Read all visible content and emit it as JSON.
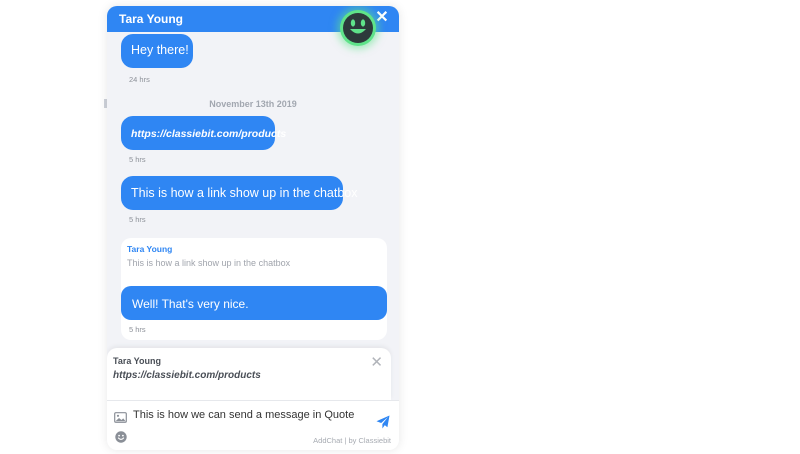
{
  "header": {
    "title": "Tara Young",
    "close_icon": "close-icon",
    "avatar_icon": "smiley-icon"
  },
  "messages": [
    {
      "text": "Hey there!",
      "time": "24 hrs"
    },
    {
      "date": "November 13th 2019"
    },
    {
      "text": "https://classiebit.com/products",
      "time": "5 hrs"
    },
    {
      "text": "This is how a link show up in the chatbox",
      "time": "5 hrs"
    },
    {
      "quote": {
        "author": "Tara Young",
        "text": "This is how a link show up in the chatbox"
      },
      "text": "Well! That's very nice.",
      "time": "5 hrs"
    }
  ],
  "quote_preview": {
    "author": "Tara Young",
    "text": "https://classiebit.com/products",
    "close_icon": "close-icon"
  },
  "composer": {
    "value": "This is how we can send a message in Quote",
    "image_icon": "image-icon",
    "emoji_icon": "emoji-icon",
    "send_icon": "send-icon",
    "brand": "AddChat | by Classiebit"
  },
  "colors": {
    "accent": "#2f86f3",
    "avatar": "#5fe38a",
    "panel_bg": "#f2f3f7",
    "muted": "#8c9098"
  }
}
